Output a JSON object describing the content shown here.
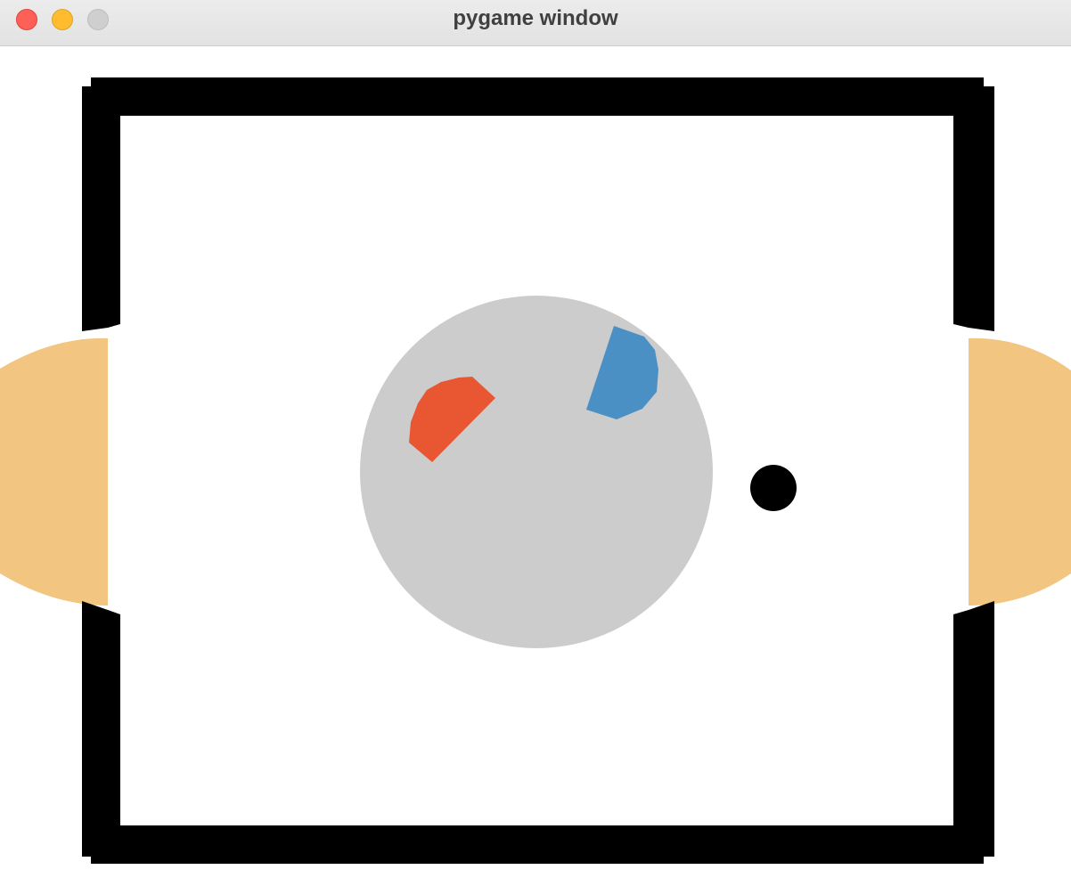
{
  "window": {
    "title": "pygame window"
  },
  "colors": {
    "wall": "#000000",
    "field": "#ffffff",
    "goal_zone": "#f2c681",
    "center_circle": "#cccccc",
    "red_player": "#e85632",
    "blue_player": "#4a90c4",
    "ball": "#000000"
  },
  "icons": {
    "close": "close-traffic-light",
    "minimize": "minimize-traffic-light",
    "zoom": "zoom-traffic-light"
  }
}
